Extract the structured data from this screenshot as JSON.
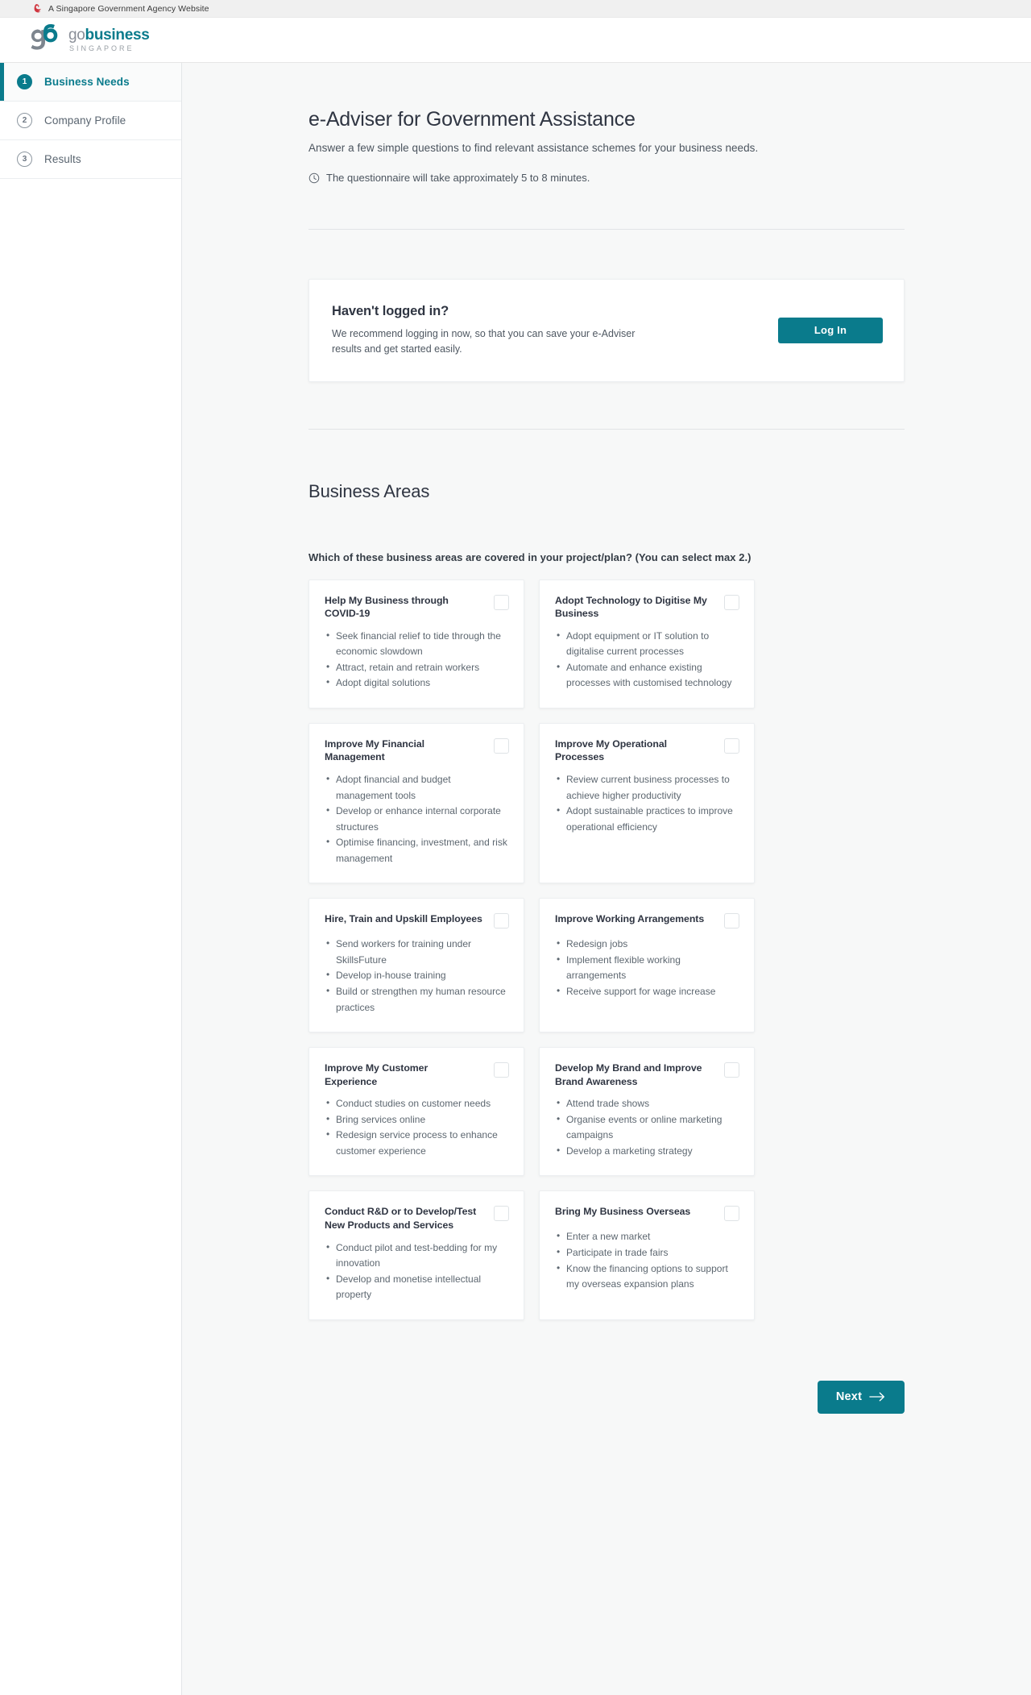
{
  "gov_banner": {
    "text": "A Singapore Government Agency Website",
    "flag_icon": "singapore-lion-icon"
  },
  "logo": {
    "mark": "gb-monogram",
    "word_go": "go",
    "word_business": "business",
    "word_country": "SINGAPORE"
  },
  "sidebar": {
    "items": [
      {
        "num": "1",
        "label": "Business Needs",
        "active": true
      },
      {
        "num": "2",
        "label": "Company Profile",
        "active": false
      },
      {
        "num": "3",
        "label": "Results",
        "active": false
      }
    ]
  },
  "header": {
    "title": "e-Adviser for Government Assistance",
    "subtitle": "Answer a few simple questions to find relevant assistance schemes for your business needs.",
    "duration_icon": "clock-icon",
    "duration": "The questionnaire will take approximately 5 to 8 minutes."
  },
  "login_card": {
    "title": "Haven't logged in?",
    "description": "We recommend logging in now, so that you can save your e-Adviser results and get started easily.",
    "button_label": "Log In"
  },
  "business_areas": {
    "section_title": "Business Areas",
    "question": "Which of these business areas are covered in your project/plan? (You can select max 2.)",
    "cards": [
      {
        "title": "Help My Business through COVID-19",
        "checked": false,
        "bullets": [
          "Seek financial relief to tide through the economic slowdown",
          "Attract, retain and retrain workers",
          "Adopt digital solutions"
        ]
      },
      {
        "title": "Adopt Technology to Digitise My Business",
        "checked": false,
        "bullets": [
          "Adopt equipment or IT solution to digitalise current processes",
          "Automate and enhance existing processes with customised technology"
        ]
      },
      {
        "title": "Improve My Financial Management",
        "checked": false,
        "bullets": [
          "Adopt financial and budget management tools",
          "Develop or enhance internal corporate structures",
          "Optimise financing, investment, and risk management"
        ]
      },
      {
        "title": "Improve My Operational Processes",
        "checked": false,
        "bullets": [
          "Review current business processes to achieve higher productivity",
          "Adopt sustainable practices to improve operational efficiency"
        ]
      },
      {
        "title": "Hire, Train and Upskill Employees",
        "checked": false,
        "bullets": [
          "Send workers for training under SkillsFuture",
          "Develop in-house training",
          "Build or strengthen my human resource practices"
        ]
      },
      {
        "title": "Improve Working Arrangements",
        "checked": false,
        "bullets": [
          "Redesign jobs",
          "Implement flexible working arrangements",
          "Receive support for wage increase"
        ]
      },
      {
        "title": "Improve My Customer Experience",
        "checked": false,
        "bullets": [
          "Conduct studies on customer needs",
          "Bring services online",
          "Redesign service process to enhance customer experience"
        ]
      },
      {
        "title": "Develop My Brand and Improve Brand Awareness",
        "checked": false,
        "bullets": [
          "Attend trade shows",
          "Organise events or online marketing campaigns",
          "Develop a marketing strategy"
        ]
      },
      {
        "title": "Conduct R&D or to Develop/Test New Products and Services",
        "checked": false,
        "bullets": [
          "Conduct pilot and test-bedding for my innovation",
          "Develop and monetise intellectual property"
        ]
      },
      {
        "title": "Bring My Business Overseas",
        "checked": false,
        "bullets": [
          "Enter a new market",
          "Participate in trade fairs",
          "Know the financing options to support my overseas expansion plans"
        ]
      }
    ]
  },
  "footer": {
    "next_label": "Next",
    "next_icon": "arrow-right-icon"
  },
  "colors": {
    "accent": "#0a7b8c",
    "page_bg": "#f7f8f8",
    "card_bg": "#ffffff",
    "flag_red": "#d0353f"
  }
}
